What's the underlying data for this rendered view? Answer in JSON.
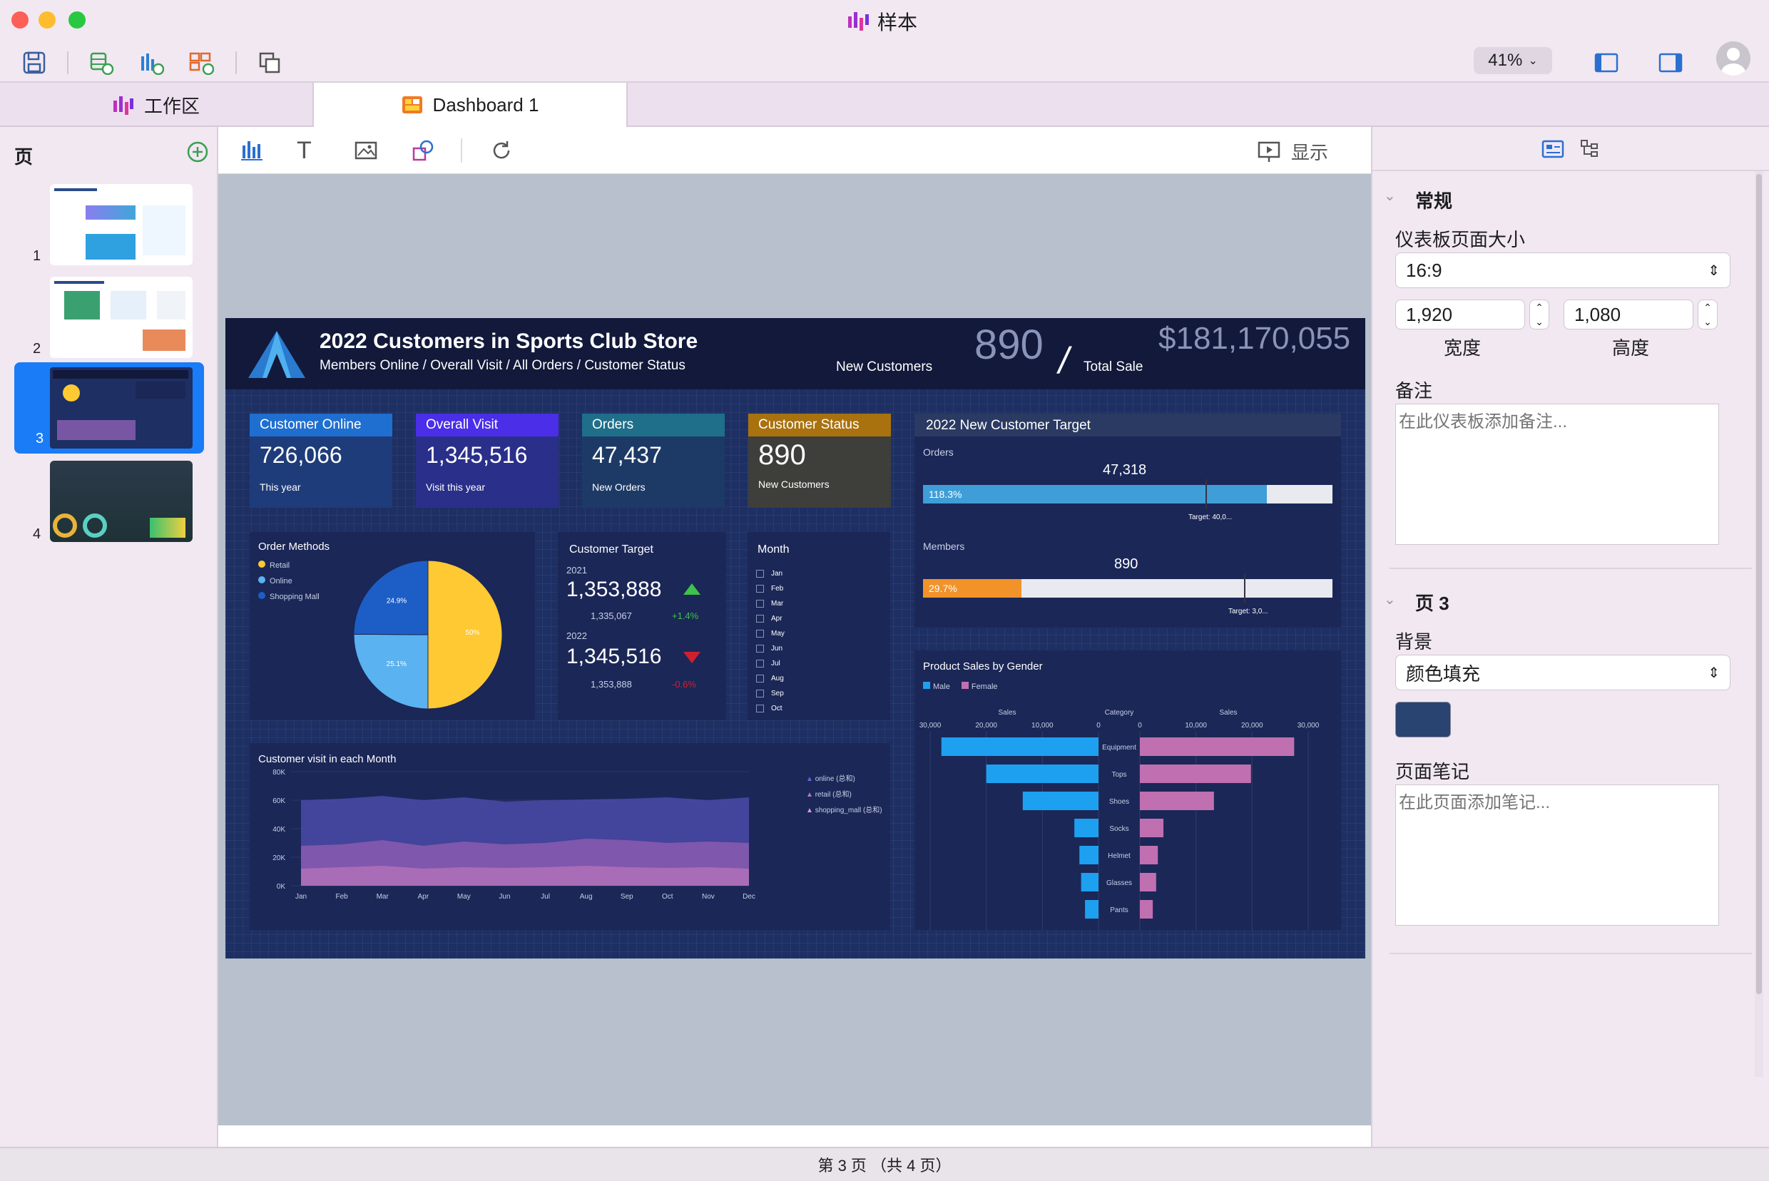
{
  "app": {
    "title": "样本",
    "zoom": "41%"
  },
  "tabs": [
    {
      "label": "工作区"
    },
    {
      "label": "Dashboard 1"
    }
  ],
  "pages": {
    "header": "页",
    "items": [
      "1",
      "2",
      "3",
      "4"
    ],
    "status": "第 3 页 （共 4 页）"
  },
  "toolbar": {
    "present": "显示"
  },
  "right": {
    "section1": "常规",
    "size_label": "仪表板页面大小",
    "size_value": "16:9",
    "width": "1,920",
    "height": "1,080",
    "width_label": "宽度",
    "height_label": "高度",
    "notes_label": "备注",
    "notes_placeholder": "在此仪表板添加备注...",
    "section2": "页 3",
    "bg_label": "背景",
    "bg_value": "颜色填充",
    "bg_color": "#2a4472",
    "page_notes_label": "页面笔记",
    "page_notes_placeholder": "在此页面添加笔记..."
  },
  "dashboard": {
    "title": "2022 Customers in Sports Club Store",
    "subtitle": "Members Online / Overall Visit / All Orders / Customer Status",
    "new_customers_value": "890",
    "new_customers_label": "New Customers",
    "slash": "/",
    "total_sale_value": "$181,170,055",
    "total_sale_label": "Total Sale",
    "kpis": [
      {
        "title": "Customer Online",
        "value": "726,066",
        "sub": "This year",
        "color": "#1f6fd0",
        "bg": "#1f3c7a"
      },
      {
        "title": "Overall Visit",
        "value": "1,345,516",
        "sub": "Visit this year",
        "color": "#4a2ee8",
        "bg": "#2a2f8a"
      },
      {
        "title": "Orders",
        "value": "47,437",
        "sub": "New Orders",
        "color": "#1f6f8a",
        "bg": "#1d3a66"
      },
      {
        "title": "Customer Status",
        "value": "890",
        "sub": "New Customers",
        "color": "#a9720e",
        "bg": "#3e3f3a"
      }
    ],
    "target": {
      "title": "2022 New Customer Target",
      "orders_label": "Orders",
      "orders_value": "47,318",
      "orders_pct": "118.3%",
      "orders_target": "Target: 40,0...",
      "orders_fill": 0.84,
      "members_label": "Members",
      "members_value": "890",
      "members_pct": "29.7%",
      "members_target": "Target: 3,0...",
      "members_fill": 0.24
    },
    "order_methods": {
      "title": "Order Methods",
      "legend": [
        "Retail",
        "Online",
        "Shopping Mall"
      ],
      "labels": [
        "50%",
        "25.1%",
        "24.9%"
      ]
    },
    "customer_target": {
      "title": "Customer Target",
      "y1": "2021",
      "v1": "1,353,888",
      "sub1": "1,335,067",
      "chg1": "+1.4%",
      "y2": "2022",
      "v2": "1,345,516",
      "sub2": "1,353,888",
      "chg2": "-0.6%"
    },
    "month": {
      "title": "Month",
      "items": [
        "Jan",
        "Feb",
        "Mar",
        "Apr",
        "May",
        "Jun",
        "Jul",
        "Aug",
        "Sep",
        "Oct"
      ]
    },
    "product_sales": {
      "title": "Product Sales by Gender",
      "legend": [
        "Male",
        "Female"
      ],
      "axis_left": "Sales",
      "axis_mid": "Category",
      "axis_right": "Sales"
    },
    "visits": {
      "title": "Customer visit in each Month",
      "legend": [
        "online (总和)",
        "retail (总和)",
        "shopping_mall (总和)"
      ]
    }
  },
  "chart_data": [
    {
      "type": "pie",
      "title": "Order Methods",
      "categories": [
        "Retail",
        "Online",
        "Shopping Mall"
      ],
      "values": [
        50,
        25.1,
        24.9
      ]
    },
    {
      "type": "bar",
      "title": "Product Sales by Gender",
      "categories": [
        "Equipment",
        "Tops",
        "Shoes",
        "Socks",
        "Helmet",
        "Glasses",
        "Pants"
      ],
      "series": [
        {
          "name": "Male",
          "values": [
            28000,
            20000,
            13500,
            4300,
            3400,
            3100,
            2400
          ]
        },
        {
          "name": "Female",
          "values": [
            27500,
            19800,
            13200,
            4200,
            3200,
            2900,
            2300
          ]
        }
      ],
      "xlim": [
        0,
        30000
      ],
      "ticks": [
        "30,000",
        "20,000",
        "10,000",
        "0",
        "0",
        "10,000",
        "20,000",
        "30,000"
      ]
    },
    {
      "type": "area",
      "title": "Customer visit in each Month",
      "categories": [
        "Jan",
        "Feb",
        "Mar",
        "Apr",
        "May",
        "Jun",
        "Jul",
        "Aug",
        "Sep",
        "Oct",
        "Nov",
        "Dec"
      ],
      "yticks": [
        "80K",
        "60K",
        "40K",
        "20K",
        "0K"
      ],
      "ylim": [
        0,
        80000
      ],
      "series": [
        {
          "name": "online (总和)",
          "values": [
            60000,
            61000,
            63000,
            60000,
            62000,
            59000,
            60000,
            60500,
            61000,
            62000,
            60000,
            62000
          ]
        },
        {
          "name": "retail (总和)",
          "values": [
            28000,
            29000,
            32000,
            28000,
            31000,
            29000,
            30000,
            33000,
            32000,
            30000,
            31000,
            30000
          ]
        },
        {
          "name": "shopping_mall (总和)",
          "values": [
            12000,
            13000,
            14000,
            12000,
            13000,
            12500,
            13000,
            14000,
            13000,
            12500,
            13000,
            12000
          ]
        }
      ]
    }
  ]
}
